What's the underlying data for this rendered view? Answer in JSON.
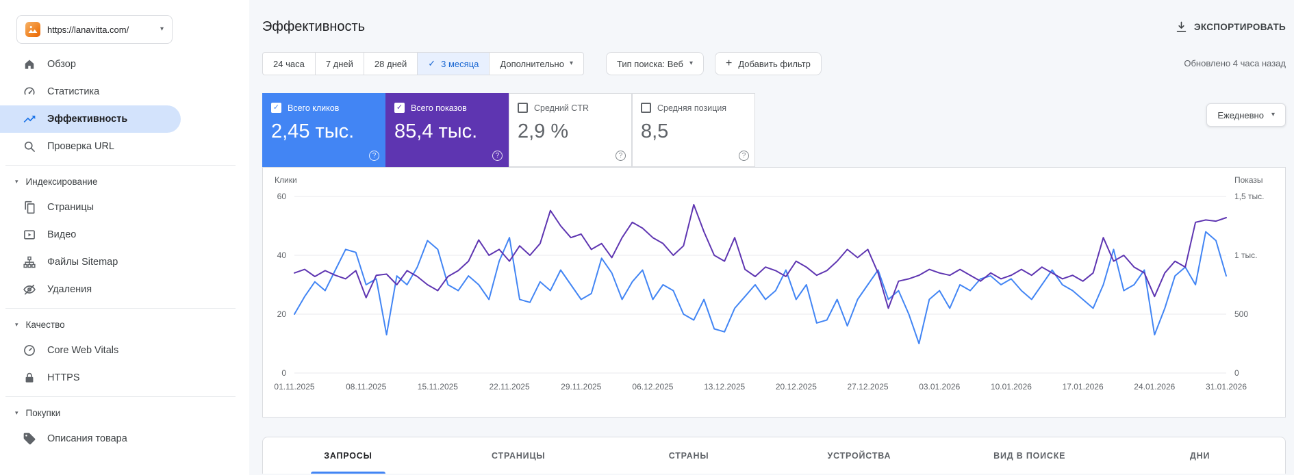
{
  "sidebar": {
    "property": {
      "url": "https://lanavitta.com/"
    },
    "items_top": [
      {
        "id": "overview",
        "label": "Обзор",
        "icon": "home-icon"
      },
      {
        "id": "insights",
        "label": "Статистика",
        "icon": "insights-icon"
      },
      {
        "id": "performance",
        "label": "Эффективность",
        "icon": "trending-up-icon",
        "selected": true
      },
      {
        "id": "url-inspection",
        "label": "Проверка URL",
        "icon": "search-icon"
      }
    ],
    "sections": [
      {
        "id": "indexing",
        "label": "Индексирование",
        "items": [
          {
            "id": "pages",
            "label": "Страницы",
            "icon": "pages-icon"
          },
          {
            "id": "video",
            "label": "Видео",
            "icon": "video-icon"
          },
          {
            "id": "sitemaps",
            "label": "Файлы Sitemap",
            "icon": "sitemap-icon"
          },
          {
            "id": "removals",
            "label": "Удаления",
            "icon": "eye-off-icon"
          }
        ]
      },
      {
        "id": "experience",
        "label": "Качество",
        "items": [
          {
            "id": "core-web-vitals",
            "label": "Core Web Vitals",
            "icon": "gauge-icon"
          },
          {
            "id": "https",
            "label": "HTTPS",
            "icon": "lock-icon"
          }
        ]
      },
      {
        "id": "shopping",
        "label": "Покупки",
        "items": [
          {
            "id": "product-snippets",
            "label": "Описания товара",
            "icon": "tag-icon"
          }
        ]
      }
    ]
  },
  "header": {
    "title": "Эффективность",
    "export_label": "ЭКСПОРТИРОВАТЬ",
    "updated": "Обновлено 4 часа назад"
  },
  "filters": {
    "date_ranges": [
      {
        "id": "24h",
        "label": "24 часа"
      },
      {
        "id": "7d",
        "label": "7 дней"
      },
      {
        "id": "28d",
        "label": "28 дней"
      },
      {
        "id": "3m",
        "label": "3 месяца",
        "selected": true
      },
      {
        "id": "more",
        "label": "Дополнительно",
        "dropdown": true
      }
    ],
    "search_type_label": "Тип поиска: Веб",
    "add_filter_label": "Добавить фильтр"
  },
  "metrics": [
    {
      "id": "clicks",
      "label": "Всего кликов",
      "value": "2,45 тыс.",
      "checked": true,
      "color": "#4285f4"
    },
    {
      "id": "impressions",
      "label": "Всего показов",
      "value": "85,4 тыс.",
      "checked": true,
      "color": "#5e35b1"
    },
    {
      "id": "ctr",
      "label": "Средний CTR",
      "value": "2,9 %",
      "checked": false
    },
    {
      "id": "position",
      "label": "Средняя позиция",
      "value": "8,5",
      "checked": false
    }
  ],
  "granularity": {
    "label": "Ежедневно"
  },
  "tabs": [
    {
      "id": "queries",
      "label": "ЗАПРОСЫ",
      "active": true
    },
    {
      "id": "pages",
      "label": "СТРАНИЦЫ"
    },
    {
      "id": "countries",
      "label": "СТРАНЫ"
    },
    {
      "id": "devices",
      "label": "УСТРОЙСТВА"
    },
    {
      "id": "search-appearance",
      "label": "ВИД В ПОИСКЕ"
    },
    {
      "id": "dates",
      "label": "ДНИ"
    }
  ],
  "chart_data": {
    "type": "line",
    "title": "Эффективность — клики и показы по дням",
    "grid": "horizontal",
    "left_axis": {
      "title": "Клики",
      "ticks": [
        0,
        20,
        40,
        60
      ],
      "max": 60
    },
    "right_axis": {
      "title": "Показы",
      "ticks": [
        "0",
        "500",
        "1 тыс.",
        "1,5 тыс."
      ],
      "tick_values": [
        0,
        500,
        1000,
        1500
      ],
      "max": 1500
    },
    "x_tick_labels": [
      "01.11.2025",
      "08.11.2025",
      "15.11.2025",
      "22.11.2025",
      "29.11.2025",
      "06.12.2025",
      "13.12.2025",
      "20.12.2025",
      "27.12.2025",
      "03.01.2026",
      "10.01.2026",
      "17.01.2026",
      "24.01.2026",
      "31.01.2026"
    ],
    "x_tick_indices": [
      0,
      7,
      14,
      21,
      28,
      35,
      42,
      49,
      56,
      63,
      70,
      77,
      84,
      91
    ],
    "series": [
      {
        "name": "Клики",
        "axis": "left",
        "color": "#4285f4",
        "values": [
          20,
          26,
          31,
          28,
          35,
          42,
          41,
          30,
          32,
          13,
          33,
          30,
          36,
          45,
          42,
          30,
          28,
          33,
          30,
          25,
          38,
          46,
          25,
          24,
          31,
          28,
          35,
          30,
          25,
          27,
          39,
          34,
          25,
          31,
          35,
          25,
          30,
          28,
          20,
          18,
          25,
          15,
          14,
          22,
          26,
          30,
          25,
          28,
          35,
          25,
          30,
          17,
          18,
          25,
          16,
          25,
          30,
          35,
          25,
          28,
          20,
          10,
          25,
          28,
          22,
          30,
          28,
          32,
          33,
          30,
          32,
          28,
          25,
          30,
          35,
          30,
          28,
          25,
          22,
          30,
          42,
          28,
          30,
          35,
          13,
          22,
          33,
          36,
          30,
          48,
          45,
          33
        ]
      },
      {
        "name": "Показы",
        "axis": "right",
        "color": "#5e35b1",
        "values": [
          850,
          880,
          820,
          870,
          830,
          800,
          870,
          640,
          830,
          840,
          750,
          870,
          820,
          750,
          700,
          820,
          870,
          950,
          1130,
          1000,
          1050,
          950,
          1080,
          1000,
          1100,
          1380,
          1250,
          1150,
          1180,
          1050,
          1100,
          980,
          1150,
          1280,
          1230,
          1150,
          1100,
          1000,
          1080,
          1430,
          1200,
          1000,
          950,
          1150,
          880,
          820,
          900,
          870,
          820,
          950,
          900,
          830,
          870,
          950,
          1050,
          980,
          1050,
          850,
          550,
          780,
          800,
          830,
          880,
          850,
          830,
          880,
          830,
          780,
          850,
          800,
          830,
          880,
          830,
          900,
          850,
          800,
          830,
          780,
          850,
          1150,
          950,
          1000,
          900,
          850,
          650,
          850,
          950,
          900,
          1280,
          1300,
          1290,
          1320
        ]
      }
    ]
  }
}
